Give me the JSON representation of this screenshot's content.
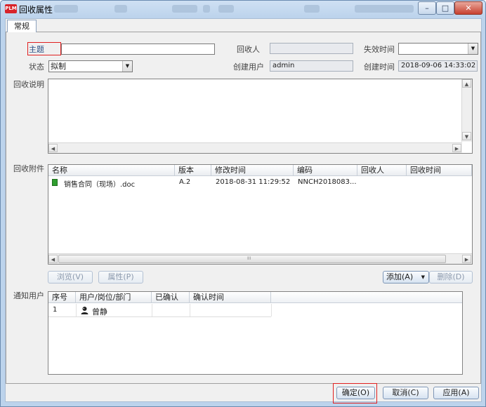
{
  "window": {
    "title": "回收属性",
    "logo": "PLM",
    "controls": {
      "minimize": "–",
      "maximize": "□",
      "close": "✕"
    }
  },
  "tab": {
    "label": "常规"
  },
  "form": {
    "subject_label": "主题",
    "subject_value": "",
    "recipient_label": "回收人",
    "recipient_value": "",
    "expire_label": "失效时间",
    "expire_value": "",
    "status_label": "状态",
    "status_value": "拟制",
    "creator_label": "创建用户",
    "creator_value": "admin",
    "created_label": "创建时间",
    "created_value": "2018-09-06 14:33:02",
    "description_label": "回收说明",
    "description_value": ""
  },
  "attachments": {
    "label": "回收附件",
    "columns": [
      "名称",
      "版本",
      "修改时间",
      "编码",
      "回收人",
      "回收时间"
    ],
    "rows": [
      {
        "name": "销售合同（现场）.doc",
        "version": "A.2",
        "modified": "2018-08-31 11:29:52",
        "code": "NNCH2018083...",
        "recipient": "",
        "recycle_time": ""
      }
    ],
    "scroll_marker": "III",
    "buttons": {
      "browse": "浏览(V)",
      "properties": "属性(P)",
      "add": "添加(A)",
      "delete": "删除(D)"
    }
  },
  "notify": {
    "label": "通知用户",
    "columns": [
      "序号",
      "用户/岗位/部门",
      "已确认",
      "确认时间"
    ],
    "rows": [
      {
        "index": "1",
        "user": "曾静",
        "confirmed": "",
        "confirm_time": ""
      }
    ]
  },
  "footer": {
    "ok": "确定(O)",
    "cancel": "取消(C)",
    "apply": "应用(A)"
  },
  "colors": {
    "accent_red": "#e02020",
    "title_blue": "#bcd3ec",
    "doc_icon_green": "#2f9e2f"
  }
}
